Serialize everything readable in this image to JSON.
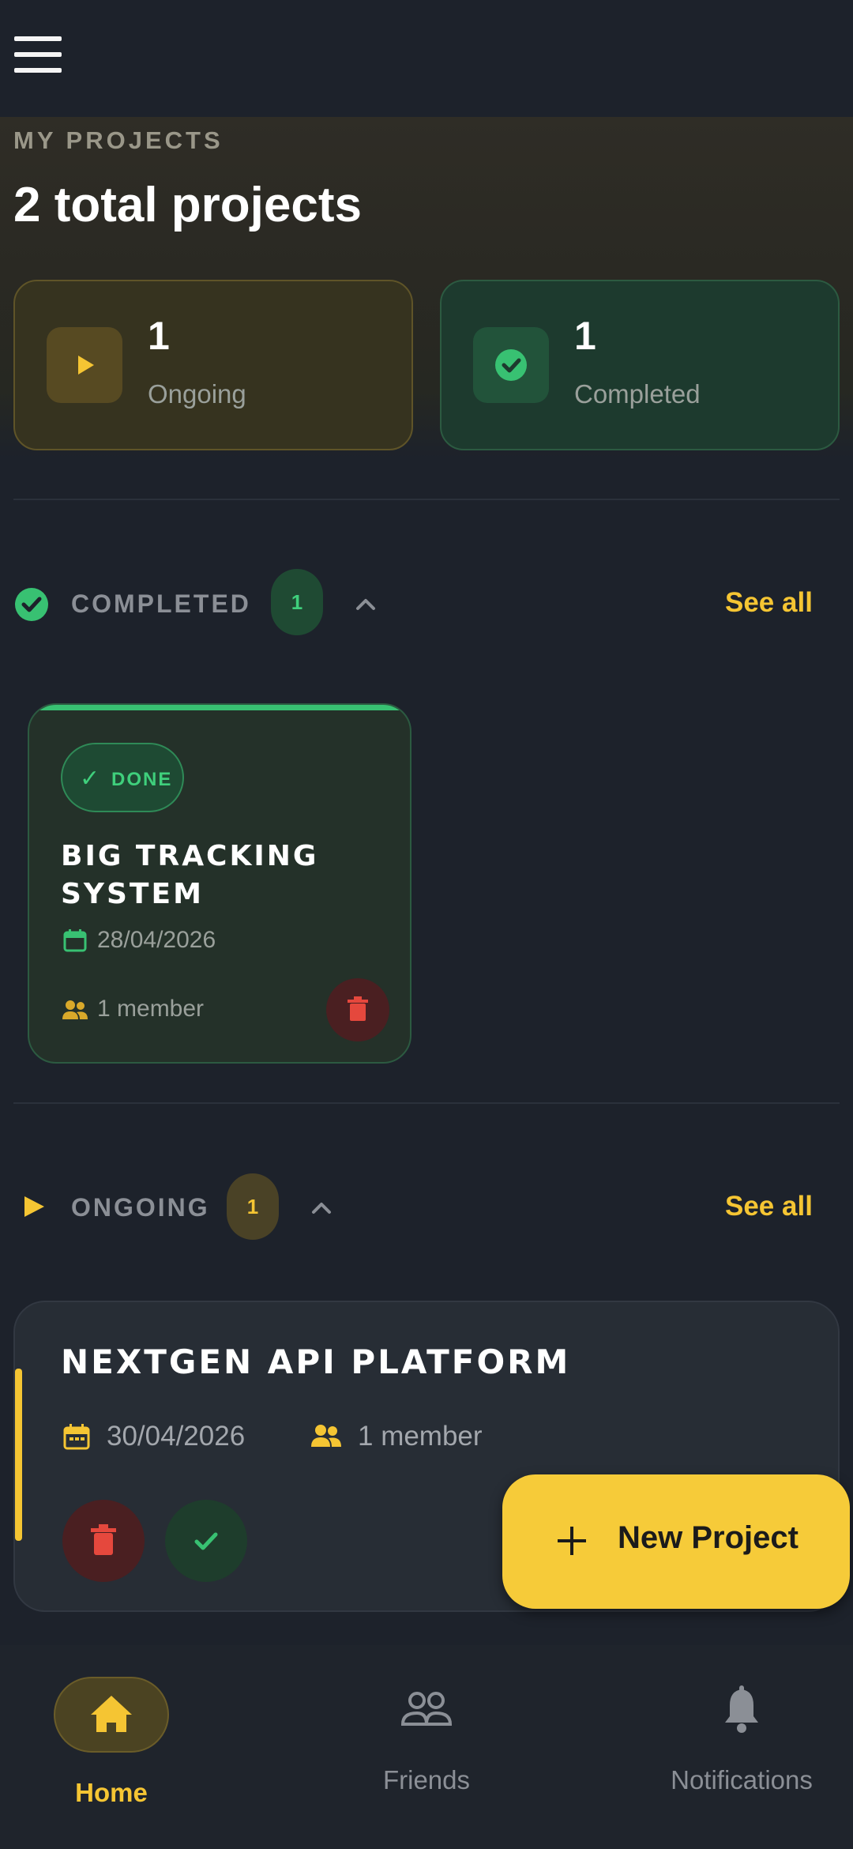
{
  "header": {
    "menu_icon": "hamburger-menu-icon"
  },
  "hero": {
    "kicker": "MY PROJECTS",
    "title": "2 total projects",
    "stats": {
      "ongoing": {
        "count": "1",
        "label": "Ongoing",
        "icon": "play-icon"
      },
      "completed": {
        "count": "1",
        "label": "Completed",
        "icon": "check-circle-icon"
      }
    }
  },
  "sections": {
    "completed": {
      "title": "COMPLETED",
      "badge": "1",
      "see_all": "See all",
      "icon": "check-circle-icon",
      "projects": [
        {
          "status": "DONE",
          "title": "BIG TRACKING SYSTEM",
          "date": "28/04/2026",
          "members": "1 member"
        }
      ]
    },
    "ongoing": {
      "title": "ONGOING",
      "badge": "1",
      "see_all": "See all",
      "icon": "play-icon",
      "projects": [
        {
          "title": "NEXTGEN API PLATFORM",
          "date": "30/04/2026",
          "members": "1 member"
        }
      ]
    }
  },
  "fab": {
    "label": "New Project",
    "icon": "plus-icon"
  },
  "bottom_nav": {
    "items": [
      {
        "label": "Home",
        "icon": "home-icon",
        "active": true
      },
      {
        "label": "Friends",
        "icon": "friends-icon",
        "active": false
      },
      {
        "label": "Notifications",
        "icon": "bell-icon",
        "active": false
      }
    ]
  },
  "colors": {
    "background": "#1d222b",
    "accent_yellow": "#f5c533",
    "success_green": "#38c172",
    "danger_red": "#e5483d"
  }
}
